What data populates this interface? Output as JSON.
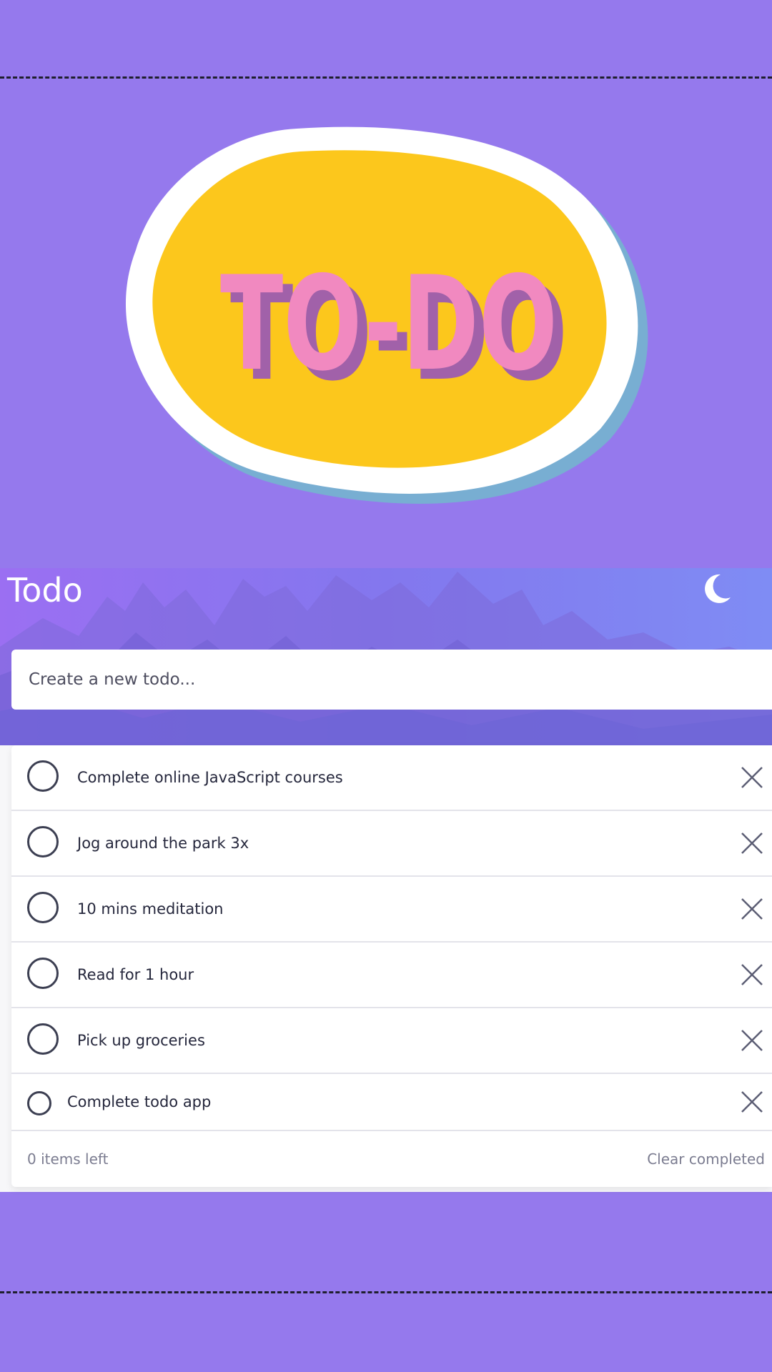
{
  "logo": {
    "text": "TO-DO"
  },
  "header": {
    "title": "Todo",
    "theme_toggle_icon": "moon-icon"
  },
  "new_todo": {
    "placeholder": "Create a new todo...",
    "value": ""
  },
  "todos": [
    {
      "text": "Complete online JavaScript courses",
      "completed": false
    },
    {
      "text": "Jog around the park 3x",
      "completed": false
    },
    {
      "text": "10 mins meditation",
      "completed": false
    },
    {
      "text": "Read for 1 hour",
      "completed": false
    },
    {
      "text": "Pick up groceries",
      "completed": false
    },
    {
      "text": "Complete todo app",
      "completed": false
    }
  ],
  "footer": {
    "items_left": "0 items left",
    "clear_completed": "Clear completed"
  },
  "colors": {
    "background": "#9579ed",
    "logo_blob": "#fcc71c",
    "logo_text": "#f189c0",
    "logo_shadow": "#a161a9",
    "header_gradient_start": "#9b6ff2",
    "header_gradient_end": "#7f8cf4",
    "text_dark": "#25273c"
  }
}
